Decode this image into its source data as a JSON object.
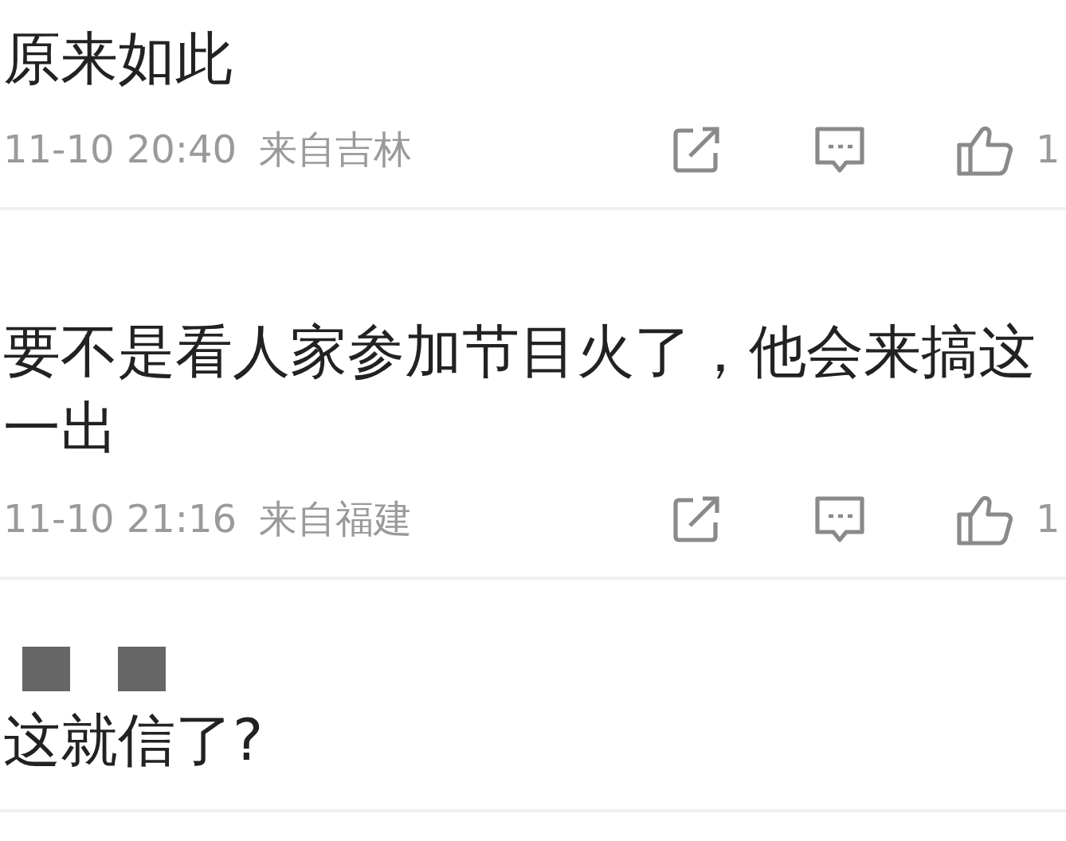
{
  "comments": [
    {
      "author_redacted": false,
      "text": "原来如此",
      "time": "11-10 20:40",
      "location": "来自吉林",
      "likes": "1"
    },
    {
      "author_redacted": false,
      "text": "要不是看人家参加节目火了，他会来搞这一出",
      "time": "11-10 21:16",
      "location": "来自福建",
      "likes": "1"
    },
    {
      "author_redacted": true,
      "text": "这就信了?"
    }
  ]
}
